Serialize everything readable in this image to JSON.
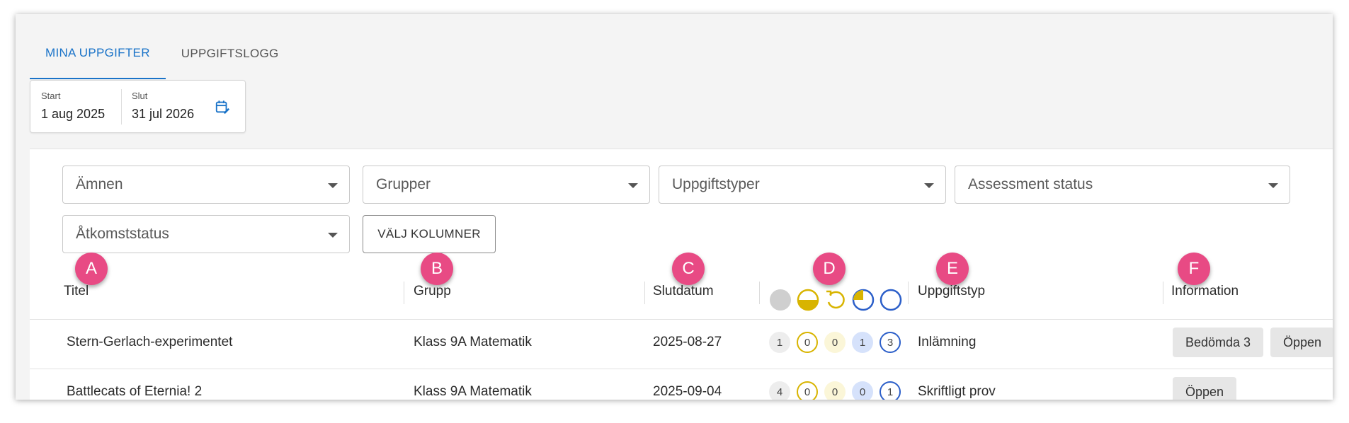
{
  "tabs": [
    {
      "label": "MINA UPPGIFTER",
      "active": true
    },
    {
      "label": "UPPGIFTSLOGG",
      "active": false
    }
  ],
  "date_range": {
    "start_label": "Start",
    "start_value": "1 aug 2025",
    "end_label": "Slut",
    "end_value": "31 jul 2026",
    "icon": "calendar-edit-icon"
  },
  "filters": {
    "subjects": "Ämnen",
    "groups": "Grupper",
    "task_types": "Uppgiftstyper",
    "assessment_status": "Assessment status",
    "access_status": "Åtkomststatus",
    "choose_columns": "VÄLJ KOLUMNER"
  },
  "markers": [
    "A",
    "B",
    "C",
    "D",
    "E",
    "F"
  ],
  "columns": {
    "title": "Titel",
    "group": "Grupp",
    "due": "Slutdatum",
    "task_type": "Uppgiftstyp",
    "information": "Information"
  },
  "status_icons": [
    "not-started-icon",
    "half-done-icon",
    "returned-icon",
    "in-progress-icon",
    "open-circle-icon"
  ],
  "rows": [
    {
      "title": "Stern-Gerlach-experimentet",
      "group": "Klass 9A Matematik",
      "due": "2025-08-27",
      "counts": [
        "1",
        "0",
        "0",
        "1",
        "3"
      ],
      "task_type": "Inlämning",
      "chips": [
        "Bedömda 3",
        "Öppen"
      ]
    },
    {
      "title": "Battlecats of Eternia! 2",
      "group": "Klass 9A Matematik",
      "due": "2025-09-04",
      "counts": [
        "4",
        "0",
        "0",
        "0",
        "1"
      ],
      "task_type": "Skriftligt prov",
      "chips": [
        "Öppen"
      ]
    }
  ],
  "colors": {
    "accent": "#1a73c8",
    "marker": "#e84a84",
    "yellow": "#d8b400",
    "blue": "#2c5fc9"
  }
}
